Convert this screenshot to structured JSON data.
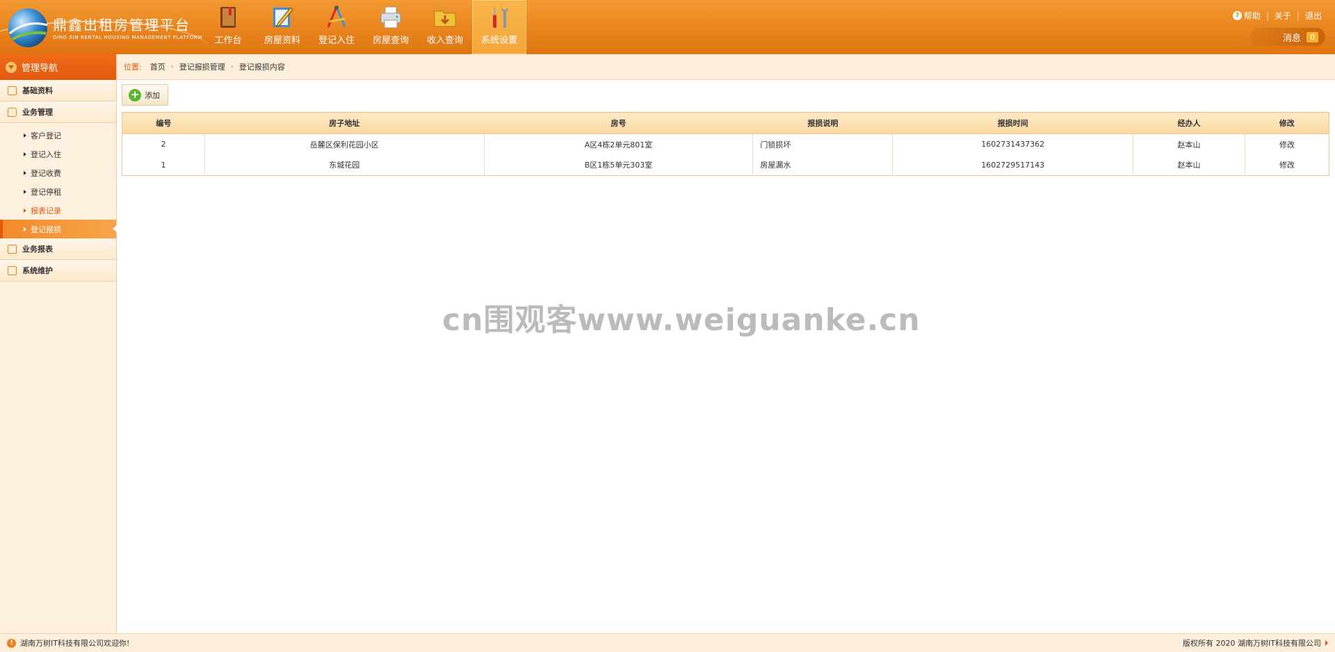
{
  "header": {
    "brand_title": "鼎鑫出租房管理平台",
    "brand_subtitle": "DING XIN RENTAL HOUSING MANAGEMENT PLATFORM",
    "nav": [
      {
        "label": "工作台",
        "icon": "book-icon"
      },
      {
        "label": "房屋资料",
        "icon": "pencil-icon"
      },
      {
        "label": "登记入住",
        "icon": "drafting-tools-icon"
      },
      {
        "label": "房屋查询",
        "icon": "printer-icon"
      },
      {
        "label": "收入查询",
        "icon": "download-folder-icon"
      },
      {
        "label": "系统设置",
        "icon": "tools-icon",
        "active": true
      }
    ],
    "links": {
      "help": "帮助",
      "about": "关于",
      "logout": "退出"
    },
    "messages": {
      "label": "消息",
      "count": "0"
    }
  },
  "sidebar": {
    "title": "管理导航",
    "groups": [
      {
        "label": "基础资料"
      },
      {
        "label": "业务管理",
        "items": [
          {
            "label": "客户登记"
          },
          {
            "label": "登记入住"
          },
          {
            "label": "登记收费"
          },
          {
            "label": "登记停租"
          },
          {
            "label": "报表记录"
          },
          {
            "label": "登记报损",
            "active": true
          }
        ]
      },
      {
        "label": "业务报表"
      },
      {
        "label": "系统维护"
      }
    ]
  },
  "breadcrumb": {
    "label": "位置:",
    "items": [
      "首页",
      "登记报损管理",
      "登记报损内容"
    ]
  },
  "toolbar": {
    "add_label": "添加"
  },
  "table": {
    "columns": [
      "编号",
      "房子地址",
      "房号",
      "报损说明",
      "报损时间",
      "经办人",
      "修改"
    ],
    "rows": [
      {
        "id": "2",
        "address": "岳麓区保利花园小区",
        "room": "A区4栋2单元801室",
        "note": "门锁损坏",
        "time": "1602731437362",
        "handler": "赵本山",
        "action": "修改"
      },
      {
        "id": "1",
        "address": "东城花园",
        "room": "B区1栋5单元303室",
        "note": "房屋漏水",
        "time": "1602729517143",
        "handler": "赵本山",
        "action": "修改"
      }
    ]
  },
  "watermark": "cn围观客www.weiguanke.cn",
  "footer": {
    "welcome": "湖南万树IT科技有限公司欢迎你!",
    "copyright": "版权所有 2020 湖南万树IT科技有限公司"
  },
  "colors": {
    "accent": "#e8821c",
    "header_dark": "#df7410",
    "sidebar_bg": "#fdf0de",
    "add_green": "#5cb531"
  }
}
